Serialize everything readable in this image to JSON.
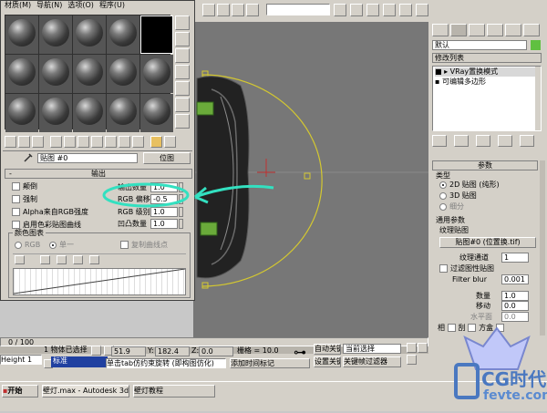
{
  "top_toolbar": {
    "view_dropdown": "视图"
  },
  "mat_editor": {
    "menu": [
      "材质(M)",
      "导航(N)",
      "选项(O)",
      "程序(U)"
    ],
    "map_name": "贴图 #0",
    "map_type": "位图",
    "output_rollout": "输出",
    "invert": "颠倒",
    "clamp": "强制",
    "alpha_from_rgb": "Alpha来自RGB强度",
    "enable_color_map": "启用色彩贴图曲线",
    "output_amount_label": "输出数量",
    "output_amount": "1.0",
    "rgb_offset_label": "RGB 偏移:",
    "rgb_offset": "-0.5",
    "rgb_level_label": "RGB 级别:",
    "rgb_level": "1.0",
    "bump_amount_label": "凹凸数量",
    "bump_amount": "1.0",
    "color_map_label": "颜色图表",
    "rgb_option": "RGB",
    "mono_option": "单一",
    "copy_curve_points": "复制曲线点"
  },
  "cmd_panel": {
    "object_name": "默认",
    "modifier_list": "修改列表",
    "stack": [
      "VRay置换模式",
      "可编辑多边形"
    ],
    "params_rollout": "参数",
    "type_label": "类型",
    "type_2d": "2D 贴图 (纯形)",
    "type_3d": "3D 贴图",
    "subdivide": "细分",
    "common_params": "通用参数",
    "texmap_label": "纹理贴图",
    "texmap_button": "贴图#0 (位置换.tif)",
    "tex_channel_label": "纹理通道",
    "tex_channel": "1",
    "filter_checkbox": "过滤图性贴图",
    "filter_blur_label": "Filter blur",
    "filter_blur": "0.001",
    "amount_label": "数量",
    "amount": "1.0",
    "shift_label": "移动",
    "shift": "0.0",
    "water_level_label": "水平面",
    "water_level": "0.0",
    "relative_bbox": "相",
    "sep": "刮",
    "cube_label": "方盒"
  },
  "status": {
    "frame_counter": "0 / 100",
    "selected": "1 物体已选择",
    "x_label": "X:",
    "x_val": "51.9",
    "y_label": "Y:",
    "y_val": "182.4",
    "z_label": "Z:",
    "z_val": "0.0",
    "grid": "栅格 = 10.0",
    "auto_key": "自动关键帧",
    "set_key": "设置关键帧",
    "selection_dropdown": "当前选择",
    "key_filters": "关键帧过滤器",
    "maxscript": "Height 1",
    "std_label": "标准",
    "prompt": "单击tab仿约束旋转 (即构图仿化)",
    "add_time_tag": "添加时间标记"
  },
  "taskbar": {
    "start": "开始",
    "item1": "壁灯.max - Autodesk 3d...",
    "item2": "壁灯教程"
  },
  "watermark": {
    "brand": "CG时代",
    "url": "fevte.com"
  },
  "colors": {
    "annotation": "#33e0c0",
    "gizmo": "#d4c830",
    "axis_red": "#c03030"
  }
}
